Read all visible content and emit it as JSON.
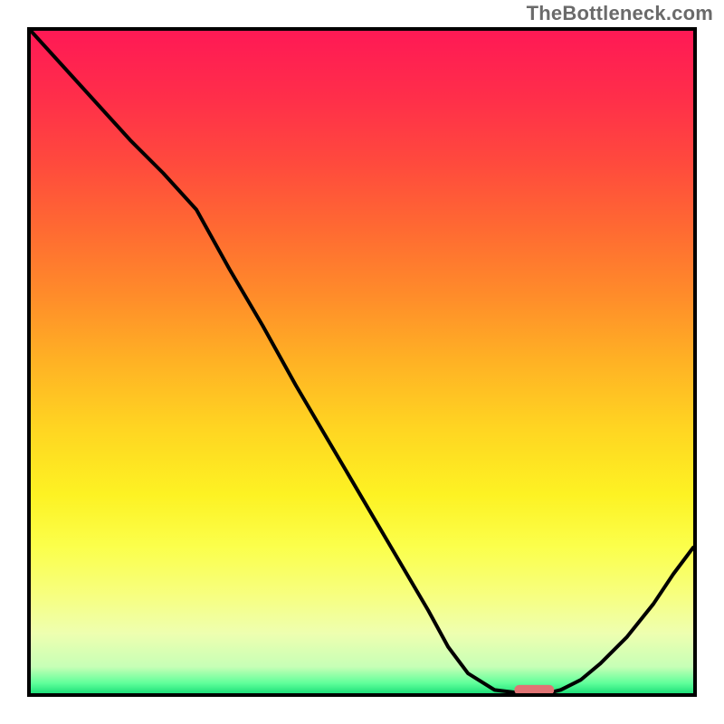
{
  "watermark": "TheBottleneck.com",
  "chart_data": {
    "type": "line",
    "title": "",
    "xlabel": "",
    "ylabel": "",
    "xlim": [
      0,
      100
    ],
    "ylim": [
      0,
      100
    ],
    "x": [
      0,
      5,
      10,
      15,
      20,
      25,
      30,
      35,
      40,
      45,
      50,
      55,
      60,
      63,
      66,
      70,
      74,
      78,
      80,
      83,
      86,
      90,
      94,
      97,
      100
    ],
    "values": [
      100,
      94.5,
      89,
      83.5,
      78.5,
      73,
      64,
      55.5,
      46.5,
      38,
      29.5,
      21,
      12.5,
      7,
      3,
      0.5,
      0,
      0,
      0.5,
      2,
      4.5,
      8.5,
      13.5,
      18,
      22
    ],
    "gradient_stops": [
      {
        "offset": 0.0,
        "color": "#ff1955"
      },
      {
        "offset": 0.1,
        "color": "#ff2e4a"
      },
      {
        "offset": 0.2,
        "color": "#ff4a3d"
      },
      {
        "offset": 0.3,
        "color": "#ff6a32"
      },
      {
        "offset": 0.4,
        "color": "#ff8c2a"
      },
      {
        "offset": 0.5,
        "color": "#ffb224"
      },
      {
        "offset": 0.6,
        "color": "#ffd522"
      },
      {
        "offset": 0.7,
        "color": "#fdf223"
      },
      {
        "offset": 0.78,
        "color": "#fbff4c"
      },
      {
        "offset": 0.85,
        "color": "#f7ff7e"
      },
      {
        "offset": 0.91,
        "color": "#eeffb0"
      },
      {
        "offset": 0.96,
        "color": "#c7ffb6"
      },
      {
        "offset": 0.985,
        "color": "#5fff9a"
      },
      {
        "offset": 1.0,
        "color": "#1fe07a"
      }
    ],
    "marker": {
      "x_start": 73,
      "x_end": 79,
      "y": 0.5,
      "color": "#e07474",
      "radius": 2
    }
  }
}
